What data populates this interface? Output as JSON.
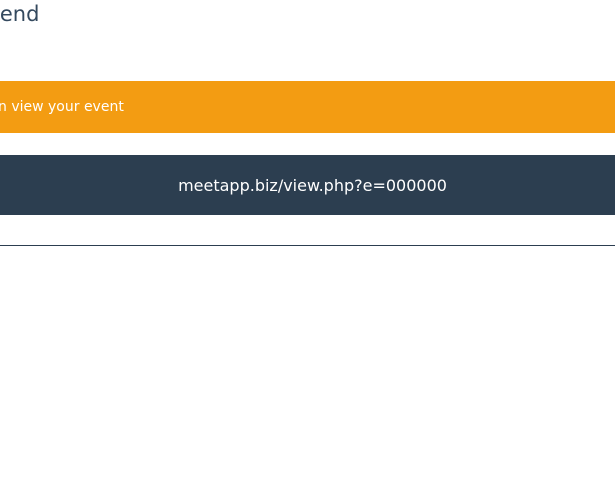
{
  "heading": {
    "text": "iend"
  },
  "banner": {
    "text": "n view your event",
    "color": "#f39c12"
  },
  "share_link": {
    "text": "meetapp.biz/view.php?e=000000",
    "background": "#2c3e50"
  }
}
